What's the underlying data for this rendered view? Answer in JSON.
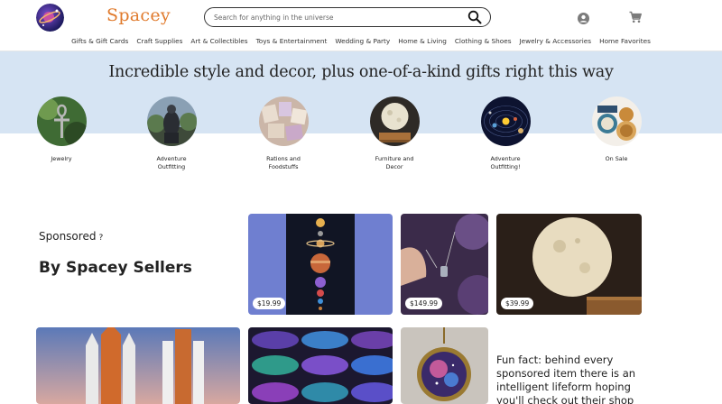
{
  "header": {
    "brand": "Spacey",
    "search_placeholder": "Search for anything in the universe",
    "nav": [
      "Gifts & Gift Cards",
      "Craft Supplies",
      "Art & Collectibles",
      "Toys & Entertainment",
      "Wedding & Party",
      "Home & Living",
      "Clothing & Shoes",
      "Jewelry & Accessories",
      "Home Favorites"
    ]
  },
  "hero": {
    "title": "Incredible style and decor, plus one-of-a-kind gifts right this way",
    "categories": [
      "Jewelry",
      "Adventure\nOutfitting",
      "Rations and\nFoodstuffs",
      "Furniture and\nDecor",
      "Adventure\nOutfitting!",
      "On Sale"
    ]
  },
  "sponsored": {
    "label": "Sponsored",
    "help": "?",
    "title": "By Spacey Sellers",
    "prices": [
      "$19.99",
      "$149.99",
      "$39.99"
    ],
    "fun_fact": "Fun fact: behind every sponsored item there is an intelligent lifeform hoping you'll check out their shop"
  },
  "colors": {
    "brand": "#e07a2c",
    "hero_band": "#d6e4f3"
  },
  "icons": [
    "logo-icon",
    "search-icon",
    "account-icon",
    "cart-icon"
  ]
}
